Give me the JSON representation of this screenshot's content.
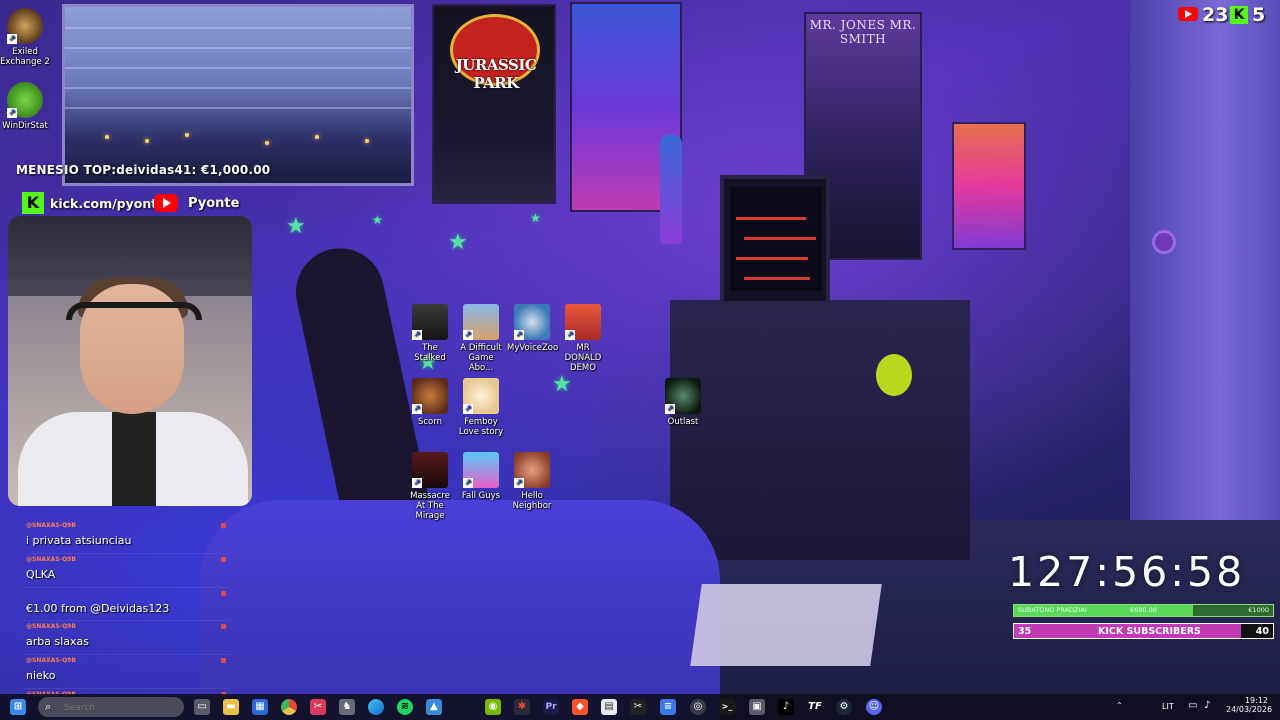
{
  "desktop_left_icons": [
    {
      "name": "exiled-exchange-icon",
      "label": "Exiled\nExchange 2"
    },
    {
      "name": "windirstat-icon",
      "label": "WinDirStat"
    }
  ],
  "desktop_icons": [
    {
      "label": "The Stalked"
    },
    {
      "label": "A Difficult Game Abo..."
    },
    {
      "label": "MyVoiceZoo"
    },
    {
      "label": "MR DONALD DEMO"
    },
    {
      "label": "Scorn"
    },
    {
      "label": "Femboy Love story"
    },
    {
      "label": "Massacre At The Mirage"
    },
    {
      "label": "Fall Guys"
    },
    {
      "label": "Hello Neighbor"
    },
    {
      "label": "Outlast"
    }
  ],
  "room": {
    "poster_jp_title": "JURASSIC PARK",
    "poster_mib_title": "MR. JONES MR. SMITH"
  },
  "stream": {
    "top_donation": "MENESIO TOP:deividas41: €1,000.00",
    "kick_url": "kick.com/pyonte",
    "youtube_name": "Pyonte",
    "youtube_viewers": "23",
    "kick_viewers": "5",
    "timer": "127:56:58",
    "goal_label": "SUBATONO PRADZIAI",
    "goal_amount": "€690.00",
    "goal_target": "€1000",
    "goal_fraction": 0.69,
    "subs_current": "35",
    "subs_label": "KICK SUBSCRIBERS",
    "subs_target": "40",
    "subs_fraction": 0.875
  },
  "chat": [
    {
      "user": "@SNAXAS-Q9B",
      "text": "i privata atsiunciau"
    },
    {
      "user": "@SNAXAS-Q9B",
      "text": "QLKA"
    },
    {
      "user": "",
      "text": "€1.00 from @Deividas123"
    },
    {
      "user": "@SNAXAS-Q9B",
      "text": "arba slaxas"
    },
    {
      "user": "@SNAXAS-Q9B",
      "text": "nieko"
    },
    {
      "user": "@SNAXAS-Q9B",
      "text": ""
    }
  ],
  "taskbar": {
    "search_placeholder": "Search",
    "apps": [
      "file-explorer-icon",
      "folder-icon",
      "store-icon",
      "chrome-icon",
      "snip-icon",
      "steam-game-icon",
      "edge-icon",
      "spotify-icon",
      "photos-icon",
      "nvidia-icon",
      "davinci-icon",
      "premiere-icon",
      "brave-icon",
      "clipboard-icon",
      "capcut-icon",
      "notepad-icon",
      "obs-icon",
      "terminal-icon",
      "vscode-icon",
      "tiktok-icon",
      "tf-icon",
      "steam-icon",
      "discord-icon"
    ],
    "lang": "LIT",
    "time": "19:12",
    "date": "24/03/2026"
  },
  "colors": {
    "kick_green": "#53fc18",
    "youtube_red": "#ff0000",
    "subs_magenta": "#c23ab6",
    "goal_green": "#59d85a"
  }
}
